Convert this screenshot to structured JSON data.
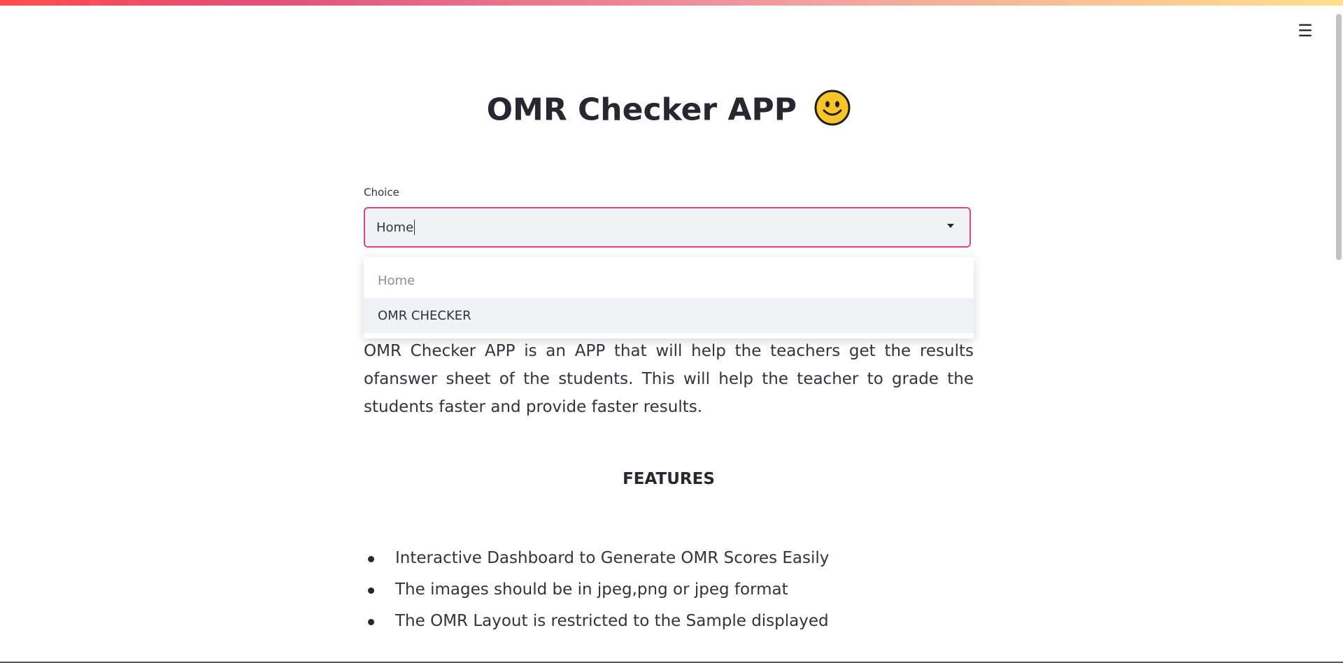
{
  "header": {
    "menu_icon": "hamburger-icon",
    "menu_glyph": "☰"
  },
  "page": {
    "title": "OMR Checker APP",
    "title_emoji": "smiley-face-icon"
  },
  "choice": {
    "label": "Choice",
    "value": "Home",
    "arrow_icon": "caret-down-icon",
    "options": [
      {
        "label": "Home"
      },
      {
        "label": "OMR CHECKER"
      }
    ]
  },
  "content": {
    "description": "OMR Checker APP is an APP that will help the teachers get the results ofanswer sheet of the students. This will help the teacher to grade the students faster and provide faster results.",
    "features_heading": "FEATURES",
    "features": [
      "Interactive Dashboard to Generate OMR Scores Easily",
      "The images should be in jpeg,png or jpeg format",
      "The OMR Layout is restricted to the Sample displayed"
    ]
  },
  "colors": {
    "accent": "#e0457b",
    "text": "#262730",
    "input_bg": "#f0f2f6",
    "emoji_fill": "#f7c52a"
  }
}
